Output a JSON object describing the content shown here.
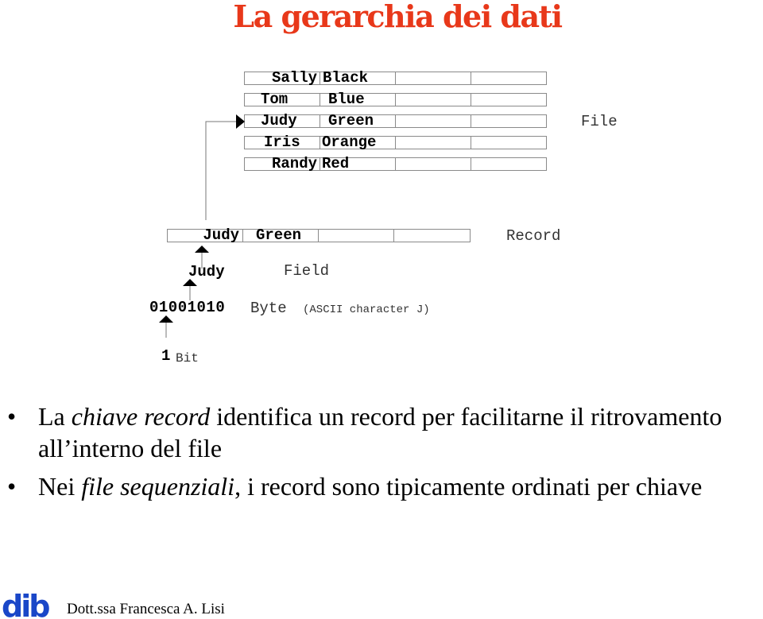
{
  "slide": {
    "title": "La gerarchia dei dati",
    "accent_color": "#e8381a"
  },
  "diagram": {
    "file_label": "File",
    "file_rows": [
      {
        "name": "Sally",
        "color": "Black"
      },
      {
        "name": "Tom",
        "color": "Blue"
      },
      {
        "name": "Judy",
        "color": "Green"
      },
      {
        "name": "Iris",
        "color": "Orange"
      },
      {
        "name": "Randy",
        "color": "Red"
      }
    ],
    "record_label": "Record",
    "record": {
      "name": "Judy",
      "color": "Green"
    },
    "field_value": "Judy",
    "field_label": "Field",
    "byte_value": "01001010",
    "byte_label": "Byte",
    "byte_note": "(ASCII character J)",
    "bit_value": "1",
    "bit_label": "Bit",
    "arrow_icons": [
      "arrow-right-icon",
      "arrow-up-icon",
      "arrow-up-icon",
      "arrow-up-icon"
    ]
  },
  "bullets": [
    {
      "parts": [
        {
          "text": "La ",
          "italic": false
        },
        {
          "text": "chiave record",
          "italic": true
        },
        {
          "text": " identifica un record per facilitarne il ritrovamento all’interno del file",
          "italic": false
        }
      ]
    },
    {
      "parts": [
        {
          "text": "Nei ",
          "italic": false
        },
        {
          "text": "file sequenziali",
          "italic": true
        },
        {
          "text": ", i record sono tipicamente ordinati per chiave",
          "italic": false
        }
      ]
    }
  ],
  "footer": {
    "logo_text": "dib",
    "logo_color": "#1a47c8",
    "author": "Dott.ssa Francesca A. Lisi"
  }
}
